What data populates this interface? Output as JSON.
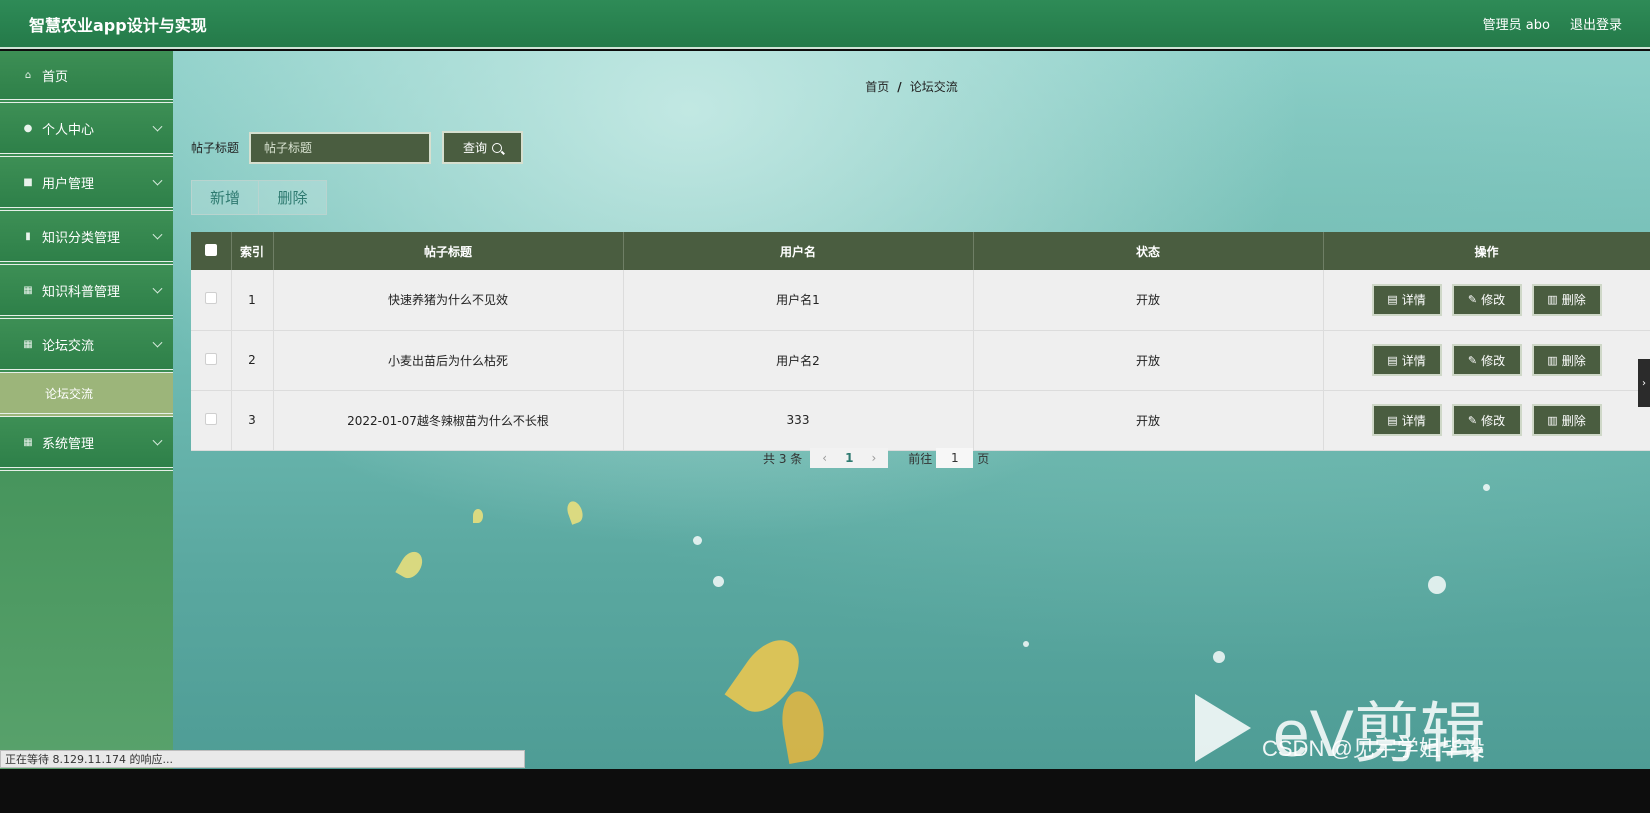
{
  "app": {
    "title": "智慧农业app设计与实现",
    "user_label": "管理员 abo",
    "logout_label": "退出登录"
  },
  "sidebar": {
    "items": [
      {
        "label": "首页",
        "icon": "home-icon"
      },
      {
        "label": "个人中心",
        "icon": "user-icon"
      },
      {
        "label": "用户管理",
        "icon": "users-icon"
      },
      {
        "label": "知识分类管理",
        "icon": "clipboard-icon"
      },
      {
        "label": "知识科普管理",
        "icon": "grid-icon"
      },
      {
        "label": "论坛交流",
        "icon": "grid-icon"
      },
      {
        "label": "系统管理",
        "icon": "grid-icon"
      }
    ],
    "sub_item": "论坛交流"
  },
  "breadcrumb": {
    "home": "首页",
    "sep": "/",
    "current": "论坛交流"
  },
  "search": {
    "label": "帖子标题",
    "placeholder": "帖子标题",
    "button": "查询"
  },
  "actions": {
    "add": "新增",
    "delete": "删除"
  },
  "table": {
    "headers": {
      "index": "索引",
      "title": "帖子标题",
      "username": "用户名",
      "status": "状态",
      "ops": "操作"
    },
    "rows": [
      {
        "index": "1",
        "title": "快速养猪为什么不见效",
        "username": "用户名1",
        "status": "开放"
      },
      {
        "index": "2",
        "title": "小麦出苗后为什么枯死",
        "username": "用户名2",
        "status": "开放"
      },
      {
        "index": "3",
        "title": "2022-01-07越冬辣椒苗为什么不长根",
        "username": "333",
        "status": "开放"
      }
    ],
    "op_labels": {
      "detail": "详情",
      "edit": "修改",
      "delete": "删除"
    }
  },
  "pager": {
    "total": "共 3 条",
    "page": "1",
    "goto_prefix": "前往",
    "goto_value": "1",
    "goto_suffix": "页"
  },
  "browser": {
    "status": "正在等待 8.129.11.174 的响应..."
  },
  "overlay": {
    "watermark": "eV剪辑",
    "credit": "CSDN @见宇学姐毕设"
  },
  "colors": {
    "topbar": "#2e8b57",
    "dark_button": "#4a5d40",
    "submenu": "#9cb57a"
  }
}
